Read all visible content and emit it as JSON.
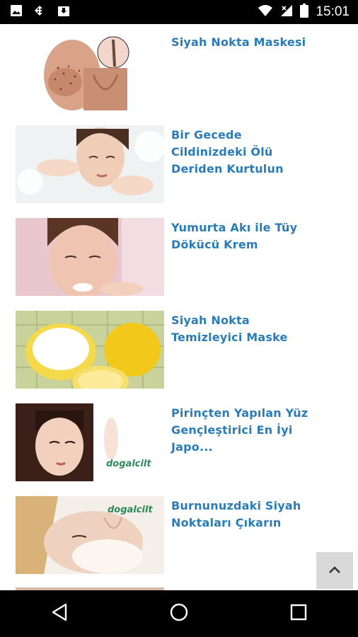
{
  "status_bar": {
    "time": "15:01",
    "left_icons": [
      "image-icon",
      "sync-icon",
      "download-icon"
    ],
    "right_icons": [
      "wifi-icon",
      "signal-icon",
      "battery-icon"
    ]
  },
  "articles": [
    {
      "title": "Siyah Nokta Maskesi",
      "image": "nose-blackheads-image"
    },
    {
      "title": "Bir Gecede Cildinizdeki Ölü Deriden Kurtulun",
      "image": "woman-face-cleansing-image"
    },
    {
      "title": "Yumurta Akı ile Tüy Dökücü Krem",
      "image": "woman-cream-nose-image"
    },
    {
      "title": "Siyah Nokta Temizleyici Maske",
      "image": "lemon-baking-soda-image"
    },
    {
      "title": "Pirinçten Yapılan Yüz Gençleştirici En İyi Japo...",
      "image": "japanese-woman-image"
    },
    {
      "title": "Burnunuzdaki Siyah Noktaları Çıkarın",
      "image": "woman-face-mask-image"
    }
  ],
  "thumb_watermark": "dogalcilt",
  "scroll_top": {
    "icon": "chevron-up-icon"
  },
  "nav_bar": {
    "icons": [
      "back-icon",
      "home-icon",
      "recents-icon"
    ]
  },
  "colors": {
    "title": "#2a7cb8",
    "status_bar": "#000000",
    "scroll_button": "#d9d9d9"
  }
}
